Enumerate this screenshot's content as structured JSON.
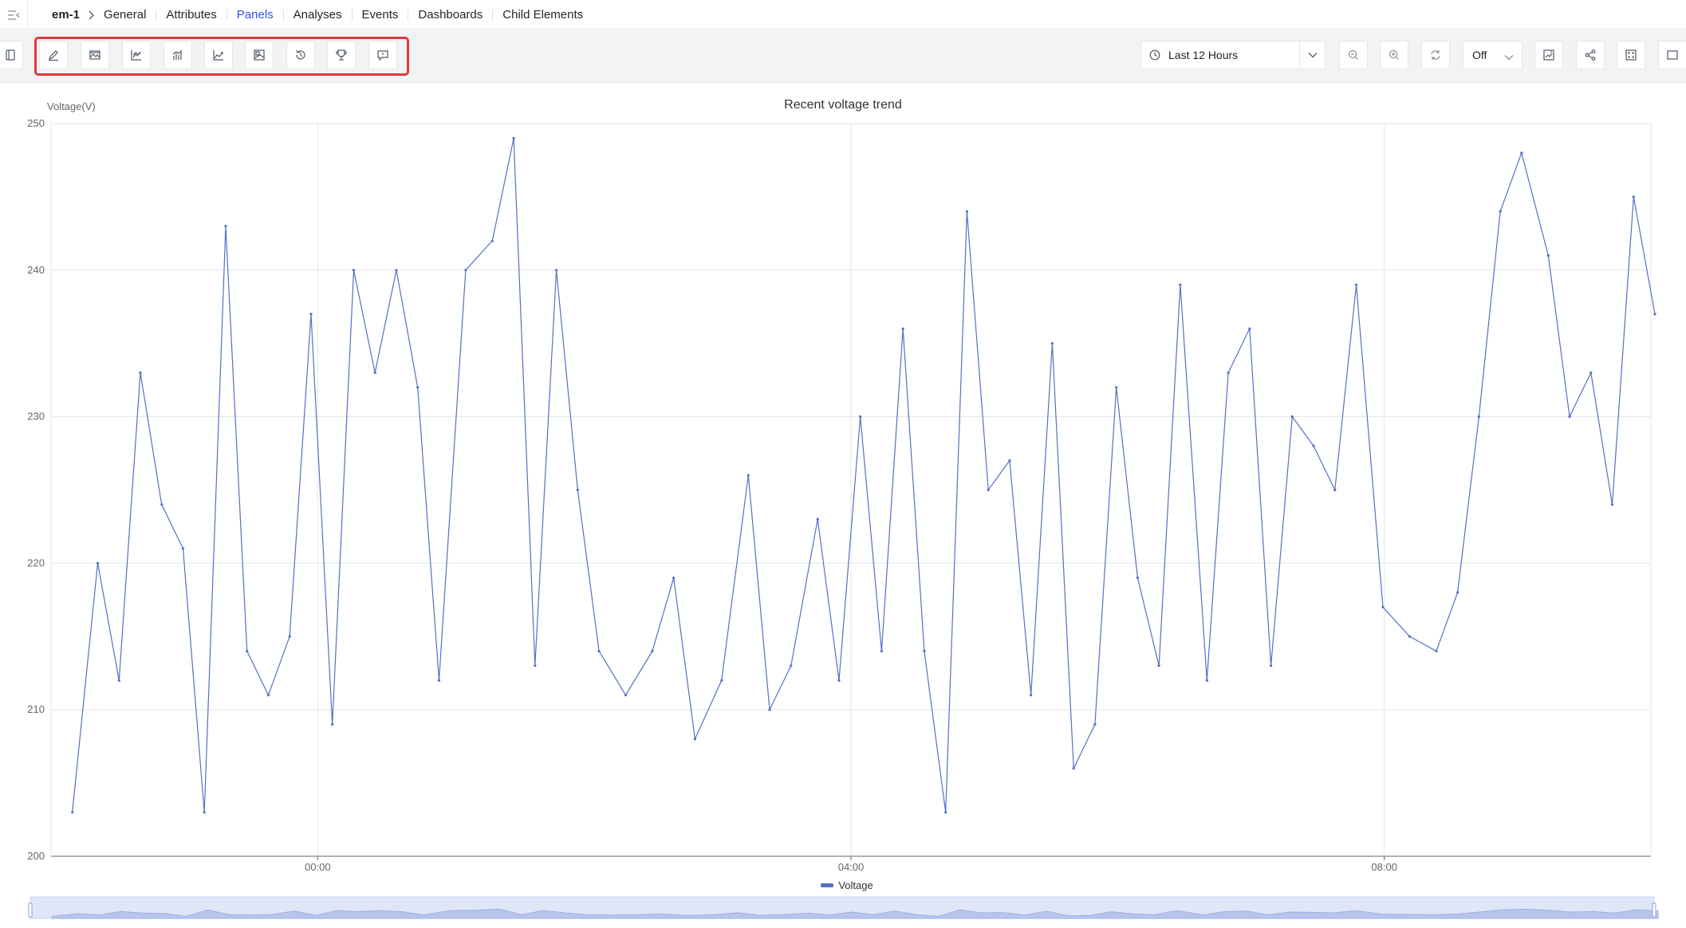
{
  "breadcrumb": {
    "device": "em-1",
    "tabs": [
      "General",
      "Attributes",
      "Panels",
      "Analyses",
      "Events",
      "Dashboards",
      "Child Elements"
    ],
    "active_tab": "Panels"
  },
  "toolbar": {
    "panel_tools": [
      "edit-icon",
      "image-panel-icon",
      "line-chart-icon",
      "bar-chart-icon",
      "area-chart-icon",
      "image-icon",
      "history-icon",
      "trophy-icon",
      "comment-icon"
    ],
    "time_range": "Last 12 Hours",
    "auto_refresh": "Off",
    "right_tools": [
      "zoom-out-icon",
      "zoom-in-icon",
      "refresh-icon",
      "auto-refresh-select",
      "save-image-icon",
      "share-icon",
      "fullscreen-icon",
      "panel-icon"
    ],
    "highlight_color": "#e03a3a"
  },
  "chart_data": {
    "type": "line",
    "title": "Recent voltage trend",
    "ylabel": "Voltage(V)",
    "ylim": [
      200,
      250
    ],
    "yticks": [
      "200",
      "210",
      "220",
      "230",
      "240",
      "250"
    ],
    "xticks": [
      "00:00",
      "04:00",
      "08:00"
    ],
    "x_range_hours": [
      -2,
      10
    ],
    "series": [
      {
        "name": "Voltage",
        "color": "#5470c6",
        "x": [
          -1.84,
          -1.65,
          -1.49,
          -1.33,
          -1.17,
          -1.01,
          -0.85,
          -0.69,
          -0.53,
          -0.37,
          -0.21,
          -0.05,
          0.11,
          0.27,
          0.43,
          0.59,
          0.75,
          0.91,
          1.11,
          1.31,
          1.47,
          1.63,
          1.79,
          1.95,
          2.11,
          2.31,
          2.51,
          2.67,
          2.83,
          3.03,
          3.23,
          3.39,
          3.55,
          3.75,
          3.91,
          4.07,
          4.23,
          4.39,
          4.55,
          4.71,
          4.87,
          5.03,
          5.19,
          5.35,
          5.51,
          5.67,
          5.83,
          5.99,
          6.15,
          6.31,
          6.47,
          6.67,
          6.83,
          6.99,
          7.15,
          7.31,
          7.47,
          7.63,
          7.79,
          7.99,
          8.19,
          8.39,
          8.55,
          8.71,
          8.87,
          9.03,
          9.23,
          9.39,
          9.55,
          9.71,
          9.87,
          10.03
        ],
        "values": [
          203,
          220,
          212,
          233,
          224,
          221,
          203,
          243,
          214,
          211,
          215,
          237,
          209,
          240,
          233,
          240,
          232,
          212,
          240,
          242,
          249,
          213,
          240,
          225,
          214,
          211,
          214,
          219,
          208,
          212,
          226,
          210,
          213,
          223,
          212,
          230,
          214,
          236,
          214,
          203,
          244,
          225,
          227,
          211,
          235,
          206,
          209,
          232,
          219,
          213,
          239,
          212,
          233,
          236,
          213,
          230,
          228,
          225,
          239,
          217,
          215,
          214,
          218,
          230,
          244,
          248,
          241,
          230,
          233,
          224,
          245,
          237
        ]
      }
    ],
    "grid": true,
    "legend": "bottom-center",
    "data_zoom_slider": true
  }
}
